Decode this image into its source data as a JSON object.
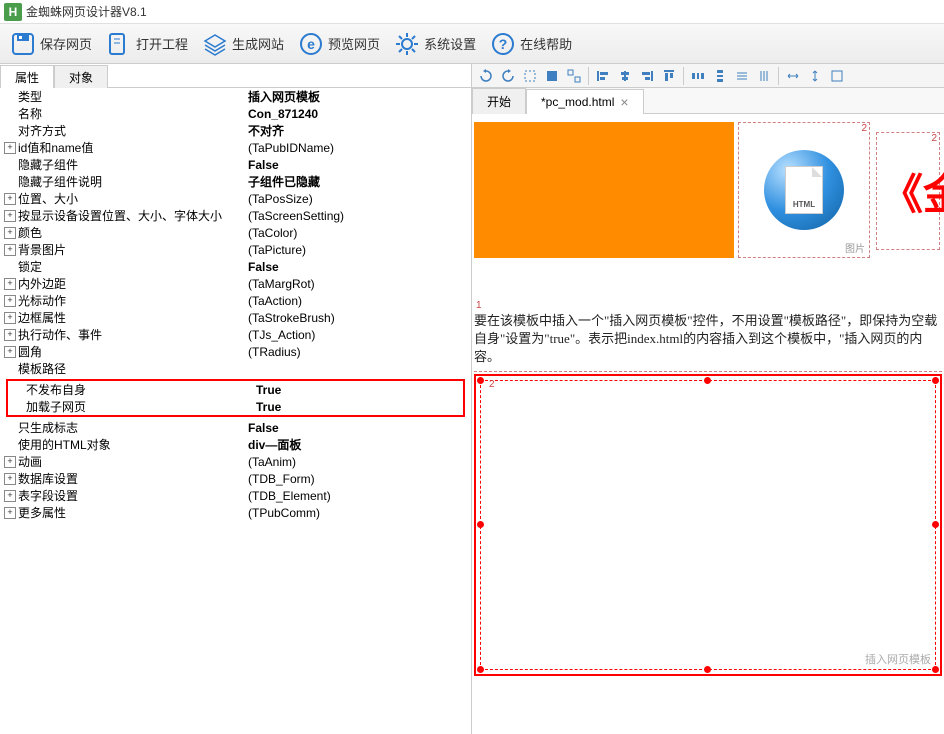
{
  "app": {
    "title": "金蜘蛛网页设计器V8.1",
    "logo_letter": "H"
  },
  "toolbar": {
    "save": "保存网页",
    "open": "打开工程",
    "generate": "生成网站",
    "preview": "预览网页",
    "settings": "系统设置",
    "help": "在线帮助"
  },
  "panel_tabs": {
    "attributes": "属性",
    "objects": "对象"
  },
  "props": [
    {
      "expand": null,
      "label": "类型",
      "value": "插入网页模板",
      "bold": true
    },
    {
      "expand": null,
      "label": "名称",
      "value": "Con_871240",
      "bold": true
    },
    {
      "expand": null,
      "label": "对齐方式",
      "value": "不对齐",
      "bold": true
    },
    {
      "expand": "+",
      "label": "id值和name值",
      "value": "(TaPubIDName)"
    },
    {
      "expand": null,
      "label": "隐藏子组件",
      "value": "False",
      "bold": true
    },
    {
      "expand": null,
      "label": "隐藏子组件说明",
      "value": "子组件已隐藏",
      "bold": true
    },
    {
      "expand": "+",
      "label": "位置、大小",
      "value": "(TaPosSize)"
    },
    {
      "expand": "+",
      "label": "按显示设备设置位置、大小、字体大小",
      "value": "(TaScreenSetting)"
    },
    {
      "expand": "+",
      "label": "颜色",
      "value": "(TaColor)"
    },
    {
      "expand": "+",
      "label": "背景图片",
      "value": "(TaPicture)"
    },
    {
      "expand": null,
      "label": "锁定",
      "value": "False",
      "bold": true
    },
    {
      "expand": "+",
      "label": "内外边距",
      "value": "(TaMargRot)"
    },
    {
      "expand": "+",
      "label": "光标动作",
      "value": "(TaAction)"
    },
    {
      "expand": "+",
      "label": "边框属性",
      "value": "(TaStrokeBrush)"
    },
    {
      "expand": "+",
      "label": "执行动作、事件",
      "value": "(TJs_Action)"
    },
    {
      "expand": "+",
      "label": "圆角",
      "value": "(TRadius)"
    },
    {
      "expand": null,
      "label": "模板路径",
      "value": ""
    }
  ],
  "props_highlight": [
    {
      "expand": null,
      "label": "不发布自身",
      "value": "True",
      "bold": true
    },
    {
      "expand": null,
      "label": "加载子网页",
      "value": "True",
      "bold": true
    }
  ],
  "props_after": [
    {
      "expand": null,
      "label": "只生成标志",
      "value": "False",
      "bold": true
    },
    {
      "expand": null,
      "label": "使用的HTML对象",
      "value": "div—面板",
      "bold": true
    },
    {
      "expand": "+",
      "label": "动画",
      "value": "(TaAnim)"
    },
    {
      "expand": "+",
      "label": "数据库设置",
      "value": "(TDB_Form)"
    },
    {
      "expand": "+",
      "label": "表字段设置",
      "value": "(TDB_Element)"
    },
    {
      "expand": "+",
      "label": "更多属性",
      "value": "(TPubComm)"
    }
  ],
  "file_tabs": {
    "start": "开始",
    "file": "*pc_mod.html"
  },
  "canvas": {
    "html_label": "HTML",
    "img_caption": "图片",
    "big_text": "《金",
    "info_num": "1",
    "info_text": "要在该模板中插入一个\"插入网页模板\"控件，不用设置\"模板路径\"，即保持为空载自身\"设置为\"true\"。表示把index.html的内容插入到这个模板中，\"插入网页的内容。",
    "template_caption": "插入网页模板",
    "badge2": "2"
  }
}
